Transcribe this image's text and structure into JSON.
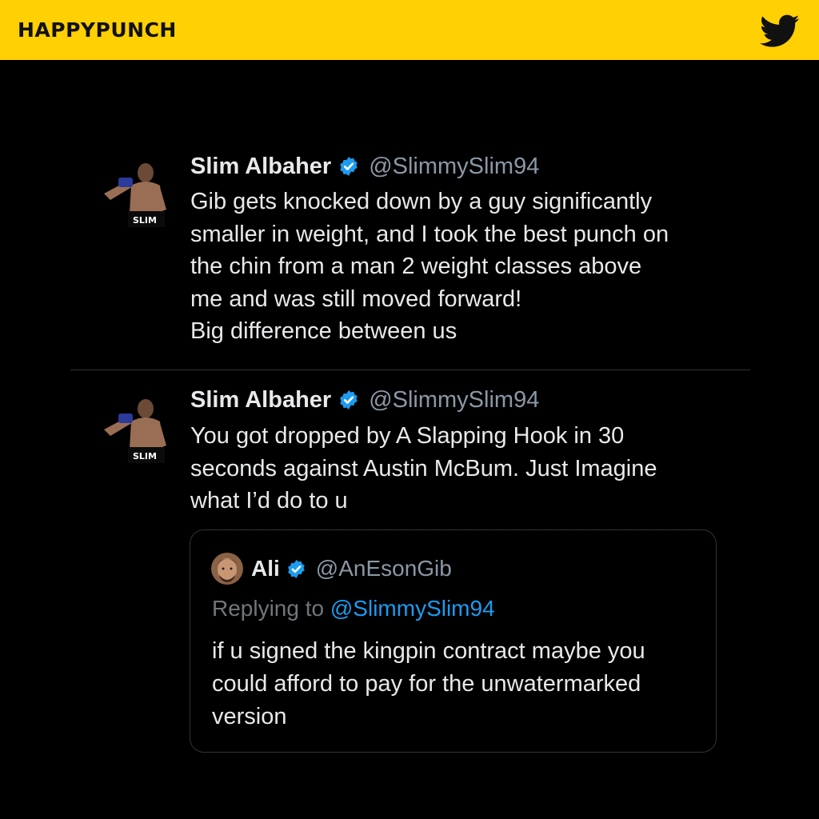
{
  "header": {
    "brand": "HAPPYPUNCH",
    "icon": "twitter-bird-icon",
    "bar_color": "#FFD003"
  },
  "tweets": [
    {
      "avatar_label": "SLIM",
      "display_name": "Slim Albaher",
      "verified_icon": "verified-badge-icon",
      "handle": "@SlimmySlim94",
      "lines": [
        "Gib gets knocked down by a guy significantly",
        "smaller in weight, and I took the best punch on",
        "the chin from a man 2 weight classes above",
        "me and was still moved forward!",
        "Big difference between us"
      ]
    },
    {
      "avatar_label": "SLIM",
      "display_name": "Slim Albaher",
      "verified_icon": "verified-badge-icon",
      "handle": "@SlimmySlim94",
      "lines": [
        "You got dropped by A Slapping Hook in 30",
        "seconds against Austin McBum. Just Imagine",
        "what I’d do to u"
      ],
      "quote": {
        "display_name": "Ali",
        "verified_icon": "verified-badge-icon",
        "handle": "@AnEsonGib",
        "replying_prefix": "Replying to ",
        "replying_handle": "@SlimmySlim94",
        "lines": [
          "if u signed the kingpin contract maybe you",
          "could afford to pay for the unwatermarked",
          "version"
        ]
      }
    }
  ],
  "colors": {
    "background": "#000000",
    "text": "#E7E9EA",
    "muted": "#8B98A5",
    "link": "#1D9BF0",
    "verified": "#1D9BF0"
  }
}
